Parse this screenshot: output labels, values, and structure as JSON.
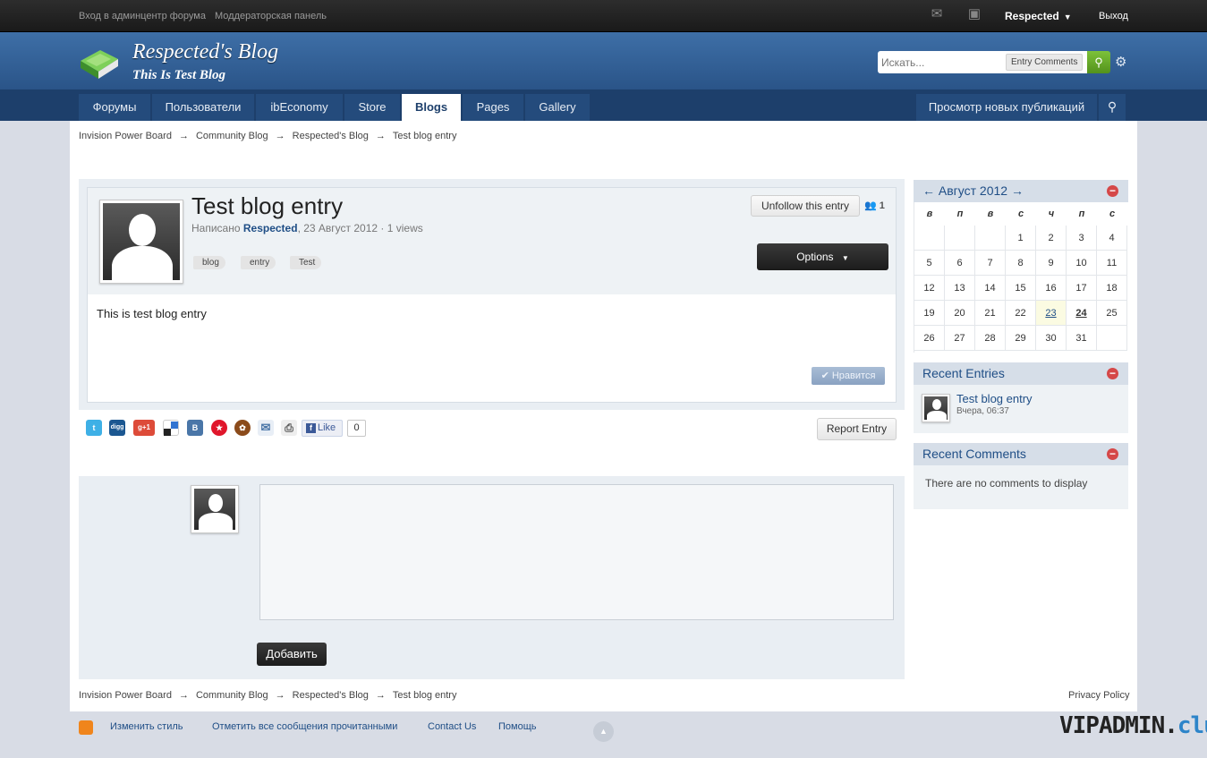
{
  "topbar": {
    "admin_link": "Вход в админцентр форума",
    "mod_link": "Моддераторская панель",
    "user": "Respected",
    "logout": "Выход"
  },
  "header": {
    "title": "Respected's Blog",
    "subtitle": "This Is Test Blog"
  },
  "search": {
    "placeholder": "Искать...",
    "scope": "Entry Comments"
  },
  "nav": {
    "tabs": [
      {
        "label": "Форумы"
      },
      {
        "label": "Пользователи"
      },
      {
        "label": "ibEconomy"
      },
      {
        "label": "Store"
      },
      {
        "label": "Blogs"
      },
      {
        "label": "Pages"
      },
      {
        "label": "Gallery"
      }
    ],
    "new_posts": "Просмотр новых публикаций"
  },
  "breadcrumb": [
    "Invision Power Board",
    "Community Blog",
    "Respected's Blog",
    "Test blog entry"
  ],
  "entry": {
    "title": "Test blog entry",
    "meta_prefix": "Написано",
    "author": "Respected",
    "meta_suffix": ", 23 Август 2012 · 1 views",
    "tags": [
      "blog",
      "entry",
      "Test"
    ],
    "unfollow": "Unfollow this entry",
    "followers": "1",
    "options": "Options",
    "body": "This is test blog entry",
    "like": "Нравится"
  },
  "share": {
    "fb_like": "Like",
    "fb_count": "0",
    "report": "Report Entry"
  },
  "comment": {
    "add": "Добавить"
  },
  "calendar": {
    "title": "← Август 2012 →",
    "weekdays": [
      "в",
      "п",
      "в",
      "с",
      "ч",
      "п",
      "с"
    ],
    "weeks": [
      [
        "",
        "",
        "",
        "1",
        "2",
        "3",
        "4"
      ],
      [
        "5",
        "6",
        "7",
        "8",
        "9",
        "10",
        "11"
      ],
      [
        "12",
        "13",
        "14",
        "15",
        "16",
        "17",
        "18"
      ],
      [
        "19",
        "20",
        "21",
        "22",
        "23",
        "24",
        "25"
      ],
      [
        "26",
        "27",
        "28",
        "29",
        "30",
        "31",
        ""
      ]
    ],
    "today": "23",
    "selected": "24"
  },
  "recent_entries": {
    "title": "Recent Entries",
    "items": [
      {
        "title": "Test blog entry",
        "date": "Вчера, 06:37"
      }
    ]
  },
  "recent_comments": {
    "title": "Recent Comments",
    "empty": "There are no comments to display"
  },
  "footer": {
    "privacy": "Privacy Policy",
    "links": [
      "Изменить стиль",
      "Отметить все сообщения прочитанными",
      "Contact Us",
      "Помощь"
    ]
  },
  "watermark": {
    "main": "VIPADMIN.",
    "accent": "club"
  },
  "colors": {
    "header": "#2f5f98",
    "nav": "#1d3f6b",
    "accent": "#1f4e86",
    "search_button": "#6ab02c"
  }
}
